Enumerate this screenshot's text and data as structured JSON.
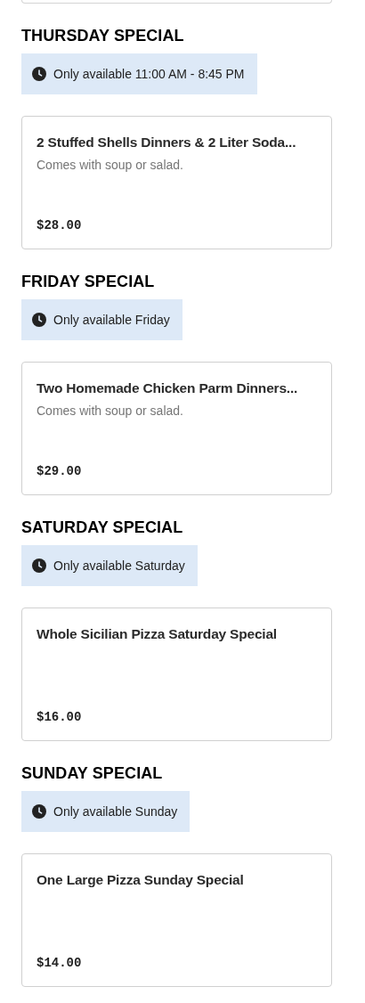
{
  "sections": [
    {
      "title": "THURSDAY SPECIAL",
      "availability": "Only available 11:00 AM - 8:45 PM",
      "items": [
        {
          "name": "2 Stuffed Shells Dinners & 2 Liter Soda...",
          "description": "Comes with soup or salad.",
          "price": "$28.00"
        }
      ]
    },
    {
      "title": "FRIDAY SPECIAL",
      "availability": "Only available Friday",
      "items": [
        {
          "name": "Two Homemade Chicken Parm Dinners...",
          "description": "Comes with soup or salad.",
          "price": "$29.00"
        }
      ]
    },
    {
      "title": "SATURDAY SPECIAL",
      "availability": "Only available Saturday",
      "items": [
        {
          "name": "Whole Sicilian Pizza Saturday Special",
          "price": "$16.00"
        }
      ]
    },
    {
      "title": "SUNDAY SPECIAL",
      "availability": "Only available Sunday",
      "items": [
        {
          "name": "One Large Pizza Sunday Special",
          "price": "$14.00"
        }
      ]
    }
  ]
}
